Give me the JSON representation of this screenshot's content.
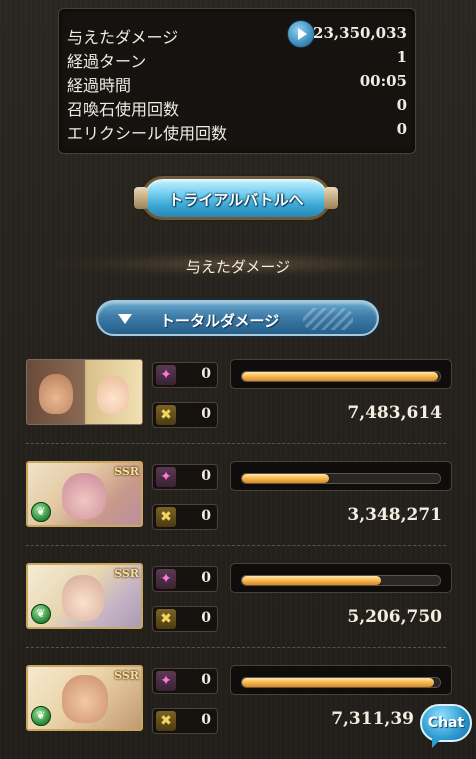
{
  "summary": {
    "rows": [
      {
        "label": "与えたダメージ",
        "value": "23,350,033"
      },
      {
        "label": "経過ターン",
        "value": "1"
      },
      {
        "label": "経過時間",
        "value": "00:05"
      },
      {
        "label": "召喚石使用回数",
        "value": "0"
      },
      {
        "label": "エリクシール使用回数",
        "value": "0"
      }
    ]
  },
  "trial_button": {
    "label": "トライアルバトルへ"
  },
  "section": {
    "title": "与えたダメージ"
  },
  "dropdown": {
    "label": "トータルダメージ"
  },
  "characters": [
    {
      "kind": "main",
      "rarity": "",
      "burst_count": "0",
      "ability_count": "0",
      "damage": "7,483,614",
      "bar_fraction": 0.99
    },
    {
      "kind": "ssr",
      "rarity": "SSR",
      "burst_count": "0",
      "ability_count": "0",
      "damage": "3,348,271",
      "bar_fraction": 0.44
    },
    {
      "kind": "ssr",
      "rarity": "SSR",
      "burst_count": "0",
      "ability_count": "0",
      "damage": "5,206,750",
      "bar_fraction": 0.7
    },
    {
      "kind": "ssr",
      "rarity": "SSR",
      "burst_count": "0",
      "ability_count": "0",
      "damage": "7,311,39",
      "bar_fraction": 0.97
    }
  ],
  "icons": {
    "play": "play-icon",
    "burst": "charge-attack-icon",
    "ability": "ability-icon",
    "element": "wind-element-icon",
    "chat": "chat-icon"
  },
  "chat": {
    "label": "Chat"
  },
  "colors": {
    "bar_fill": "#f5b14a",
    "accent_blue": "#3aa7d4"
  }
}
